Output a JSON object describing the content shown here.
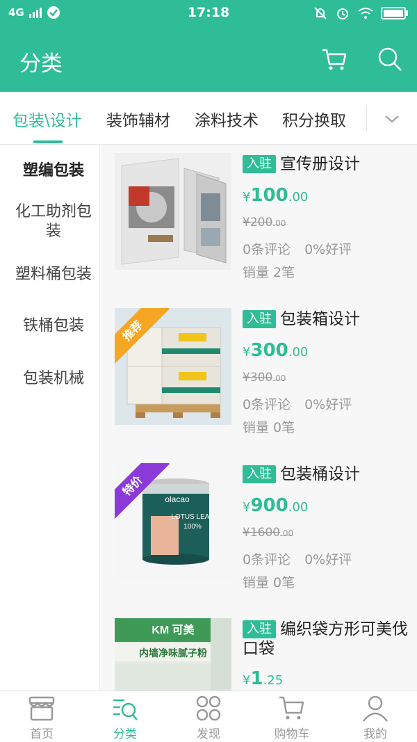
{
  "statusbar": {
    "network": "4G",
    "time": "17:18"
  },
  "header": {
    "title": "分类"
  },
  "tabs": [
    {
      "label": "包装\\设计",
      "active": true
    },
    {
      "label": "装饰辅材"
    },
    {
      "label": "涂料技术"
    },
    {
      "label": "积分换取"
    }
  ],
  "sidebar": {
    "items": [
      {
        "label": "塑编包装",
        "active": true
      },
      {
        "label": "化工助剂包装"
      },
      {
        "label": "塑料桶包装"
      },
      {
        "label": "铁桶包装"
      },
      {
        "label": "包装机械"
      }
    ]
  },
  "products": [
    {
      "tag": "入驻",
      "title": "宣传册设计",
      "currency": "¥",
      "price_int": "100",
      "price_dec": ".00",
      "old_int": "¥200",
      "old_dec": ".00",
      "comments": "0条评论",
      "rating": "0%好评",
      "sales": "销量 2笔"
    },
    {
      "tag": "入驻",
      "title": "包装箱设计",
      "ribbon": "推荐",
      "currency": "¥",
      "price_int": "300",
      "price_dec": ".00",
      "old_int": "¥300",
      "old_dec": ".00",
      "comments": "0条评论",
      "rating": "0%好评",
      "sales": "销量 0笔"
    },
    {
      "tag": "入驻",
      "title": "包装桶设计",
      "ribbon": "特价",
      "currency": "¥",
      "price_int": "900",
      "price_dec": ".00",
      "old_int": "¥1600",
      "old_dec": ".00",
      "comments": "0条评论",
      "rating": "0%好评",
      "sales": "销量 0笔",
      "image_text": {
        "brand": "olacao",
        "product": "LOTUS LEAF",
        "percent": "100%"
      }
    },
    {
      "tag": "入驻",
      "title": "编织袋方形可美伐口袋",
      "currency": "¥",
      "price_int": "1",
      "price_dec": ".25",
      "image_text": {
        "brand": "KM 可美",
        "product": "内墙净味腻子粉"
      }
    }
  ],
  "bottom_nav": [
    {
      "label": "首页",
      "icon": "store-icon"
    },
    {
      "label": "分类",
      "icon": "category-search-icon",
      "active": true
    },
    {
      "label": "发现",
      "icon": "discover-grid-icon"
    },
    {
      "label": "购物车",
      "icon": "cart-icon"
    },
    {
      "label": "我的",
      "icon": "user-icon"
    }
  ],
  "colors": {
    "primary": "#2ebd96",
    "ribbon_recommend": "#f5a623",
    "ribbon_sale": "#8b3ad9",
    "muted": "#999999"
  }
}
